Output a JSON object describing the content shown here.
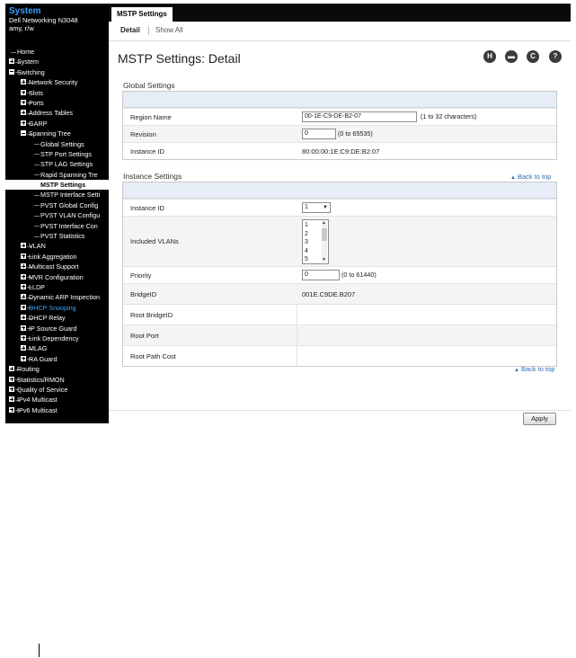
{
  "system": {
    "title": "System",
    "model": "Dell Networking N3048",
    "user": "amy, r/w"
  },
  "nav": [
    {
      "label": "Home",
      "level": 0,
      "expander": "none"
    },
    {
      "label": "System",
      "level": 0,
      "expander": "plus"
    },
    {
      "label": "Switching",
      "level": 0,
      "expander": "minus"
    },
    {
      "label": "Network Security",
      "level": 1,
      "expander": "plus"
    },
    {
      "label": "Slots",
      "level": 1,
      "expander": "plus"
    },
    {
      "label": "Ports",
      "level": 1,
      "expander": "plus"
    },
    {
      "label": "Address Tables",
      "level": 1,
      "expander": "plus"
    },
    {
      "label": "GARP",
      "level": 1,
      "expander": "plus"
    },
    {
      "label": "Spanning Tree",
      "level": 1,
      "expander": "minus"
    },
    {
      "label": "Global Settings",
      "level": 2,
      "expander": "none"
    },
    {
      "label": "STP Port Settings",
      "level": 2,
      "expander": "none"
    },
    {
      "label": "STP LAG Settings",
      "level": 2,
      "expander": "none"
    },
    {
      "label": "Rapid Spanning Tre",
      "level": 2,
      "expander": "none"
    },
    {
      "label": "MSTP Settings",
      "level": 2,
      "expander": "none",
      "selected": true
    },
    {
      "label": "MSTP Interface Setti",
      "level": 2,
      "expander": "none"
    },
    {
      "label": "PVST Global Config",
      "level": 2,
      "expander": "none"
    },
    {
      "label": "PVST VLAN Configu",
      "level": 2,
      "expander": "none"
    },
    {
      "label": "PVST Interface Con",
      "level": 2,
      "expander": "none"
    },
    {
      "label": "PVST Statistics",
      "level": 2,
      "expander": "none"
    },
    {
      "label": "VLAN",
      "level": 1,
      "expander": "plus"
    },
    {
      "label": "Link Aggregation",
      "level": 1,
      "expander": "plus"
    },
    {
      "label": "Multicast Support",
      "level": 1,
      "expander": "plus"
    },
    {
      "label": "MVR Configuration",
      "level": 1,
      "expander": "plus"
    },
    {
      "label": "LLDP",
      "level": 1,
      "expander": "plus"
    },
    {
      "label": "Dynamic ARP Inspection",
      "level": 1,
      "expander": "plus"
    },
    {
      "label": "DHCP Snooping",
      "level": 1,
      "expander": "plus",
      "highlight": true
    },
    {
      "label": "DHCP Relay",
      "level": 1,
      "expander": "plus"
    },
    {
      "label": "IP Source Guard",
      "level": 1,
      "expander": "plus"
    },
    {
      "label": "Link Dependency",
      "level": 1,
      "expander": "plus"
    },
    {
      "label": "MLAG",
      "level": 1,
      "expander": "plus"
    },
    {
      "label": "RA Guard",
      "level": 1,
      "expander": "plus"
    },
    {
      "label": "Routing",
      "level": 0,
      "expander": "plus"
    },
    {
      "label": "Statistics/RMON",
      "level": 0,
      "expander": "plus"
    },
    {
      "label": "Quality of Service",
      "level": 0,
      "expander": "plus"
    },
    {
      "label": "IPv4 Multicast",
      "level": 0,
      "expander": "plus"
    },
    {
      "label": "IPv6 Multicast",
      "level": 0,
      "expander": "plus"
    }
  ],
  "tabs": {
    "active": "MSTP Settings",
    "detail": "Detail",
    "show_all": "Show All"
  },
  "page_title": "MSTP Settings: Detail",
  "toolbar": {
    "icons": [
      "save-icon",
      "print-icon",
      "refresh-icon",
      "help-icon"
    ],
    "glyphs": [
      "H",
      "▬",
      "C",
      "?"
    ]
  },
  "global_settings": {
    "title": "Global Settings",
    "region_name": {
      "label": "Region Name",
      "value": "00-1E-C9-DE-B2-07",
      "hint": "(1 to 32 characters)"
    },
    "revision": {
      "label": "Revision",
      "value": "0",
      "hint": "(0 to 65535)"
    },
    "instance_id": {
      "label": "Instance ID",
      "value": "80:00:00:1E:C9:DE:B2:07"
    }
  },
  "instance_settings": {
    "title": "Instance Settings",
    "back_to_top": "Back to top",
    "instance_id": {
      "label": "Instance ID",
      "value": "1"
    },
    "included_vlans": {
      "label": "Included VLANs",
      "options": [
        "1",
        "2",
        "3",
        "4",
        "5"
      ]
    },
    "priority": {
      "label": "Priority",
      "value": "0",
      "hint": "(0 to 61440)"
    },
    "bridge_id": {
      "label": "BridgeID",
      "value": "001E.C9DE.B207"
    },
    "root_bridge_id": {
      "label": "Root BridgeID",
      "value": ""
    },
    "root_port": {
      "label": "Root Port",
      "value": ""
    },
    "root_path_cost": {
      "label": "Root Path Cost",
      "value": ""
    }
  },
  "back_to_top_bottom": "Back to top",
  "apply_label": "Apply"
}
